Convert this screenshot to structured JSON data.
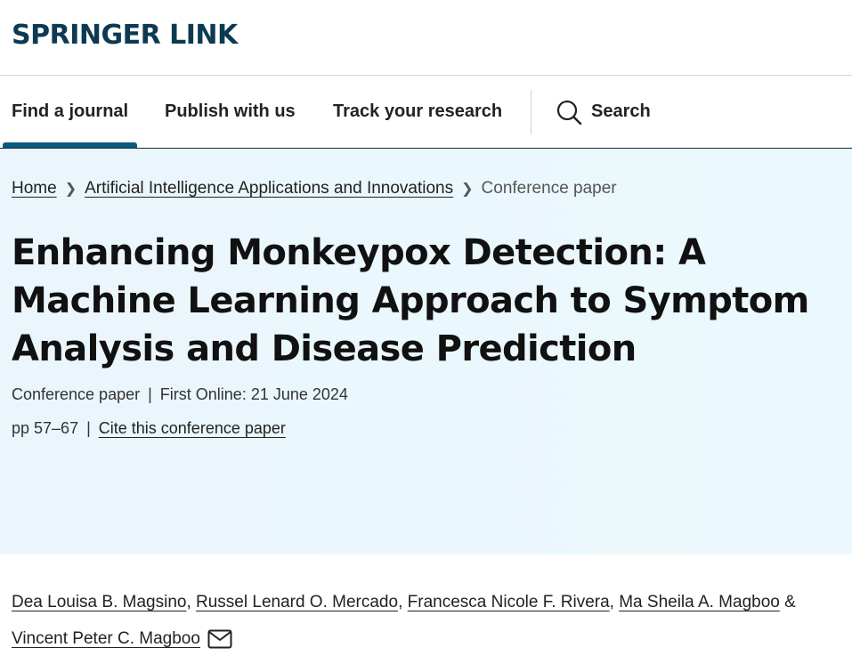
{
  "site": {
    "logo": "SPRINGER LINK"
  },
  "nav": {
    "items": [
      {
        "label": "Find a journal",
        "active": true
      },
      {
        "label": "Publish with us"
      },
      {
        "label": "Track your research"
      }
    ],
    "search_label": "Search"
  },
  "breadcrumb": {
    "home": "Home",
    "book": "Artificial Intelligence Applications and Innovations",
    "current": "Conference paper"
  },
  "article": {
    "title": "Enhancing Monkeypox Detection: A Machine Learning Approach to Symptom Analysis and Disease Prediction",
    "type": "Conference paper",
    "first_online": "First Online: 21 June 2024",
    "pages": "pp 57–67",
    "cite_label": "Cite this conference paper"
  },
  "authors": [
    "Dea Louisa B. Magsino",
    "Russel Lenard O. Mercado",
    "Francesca Nicole F. Rivera",
    "Ma Sheila A. Magboo",
    "Vincent Peter C. Magboo"
  ],
  "separators": {
    "comma": ",",
    "amp": "&",
    "pipe": "|"
  },
  "colors": {
    "brand": "#0d3a52",
    "nav_active": "#0b5a7f",
    "hero_bg": "#eaf6fb"
  }
}
